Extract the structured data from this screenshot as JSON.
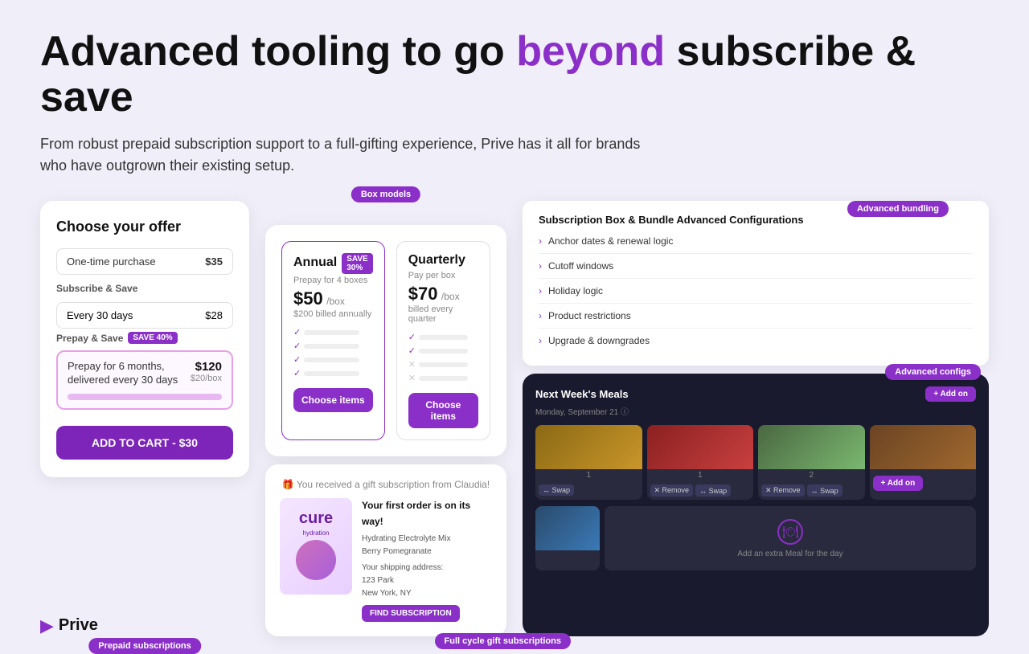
{
  "headline": {
    "before": "Advanced tooling to go ",
    "highlight": "beyond",
    "after": " subscribe & save"
  },
  "subheadline": "From robust prepaid subscription support to a full-gifting experience, Prive has it all for brands who have outgrown their existing setup.",
  "offer_card": {
    "title": "Choose your offer",
    "one_time": {
      "label": "One-time purchase",
      "price": "$35"
    },
    "subscribe_save": {
      "label": "Subscribe & Save",
      "every_days_label": "Every 30 days",
      "price": "$28"
    },
    "prepay_save": {
      "label": "Prepay & Save",
      "badge": "SAVE 40%",
      "description": "Prepay for 6 months, delivered every 30 days",
      "price": "$120",
      "per_box": "$20/box"
    },
    "add_to_cart": "ADD TO CART - $30"
  },
  "pill_labels": {
    "prepaid": "Prepaid subscriptions",
    "box_models": "Box models",
    "advanced_bundling": "Advanced bundling",
    "advanced_configs": "Advanced configs",
    "full_cycle_gift": "Full cycle gift subscriptions"
  },
  "box_models": {
    "plans": [
      {
        "name": "Annual",
        "badge": "SAVE 30%",
        "sub": "Prepay for 4 boxes",
        "price": "$50",
        "unit": "/box",
        "billed": "$200 billed annually",
        "button": "Choose items",
        "features": [
          "check",
          "check",
          "check",
          "check"
        ]
      },
      {
        "name": "Quarterly",
        "badge": null,
        "sub": "Pay per box",
        "price": "$70",
        "unit": "/box",
        "billed": "billed every quarter",
        "button": "Choose items",
        "features": [
          "check",
          "check",
          "cross",
          "cross"
        ]
      }
    ]
  },
  "gift_subscription": {
    "header": "🎁 You received a gift subscription from Claudia!",
    "title": "Your first order is on its way!",
    "product": "Hydrating Electrolyte Mix",
    "flavor": "Berry Pomegranate",
    "shipping": "Your shipping address:",
    "address": "123 Park\nNew York, NY",
    "confirm_btn": "FIND SUBSCRIPTION"
  },
  "config_panel": {
    "title": "Subscription Box & Bundle Advanced Configurations",
    "items": [
      "Anchor dates & renewal logic",
      "Cutoff windows",
      "Holiday logic",
      "Product restrictions",
      "Upgrade & downgrades"
    ]
  },
  "meal_planner": {
    "title": "Next Week's Meals",
    "date": "Monday, September 21 ⓘ",
    "add_btn": "+ Add on",
    "add_meal_text": "Add an extra Meal for the day"
  },
  "logo": {
    "text": "Prive"
  }
}
